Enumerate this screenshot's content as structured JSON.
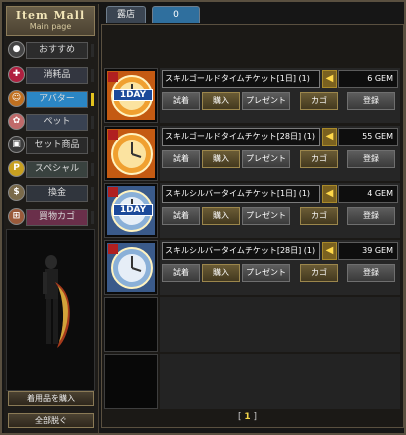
{
  "sidebar": {
    "title": "Item Mall",
    "subtitle": "Main page",
    "nav": [
      {
        "label": "おすすめ",
        "icon": "sphere-icon",
        "icon_color": "#444444",
        "label_bg": "#2c2c2c"
      },
      {
        "label": "消耗品",
        "icon": "potion-icon",
        "icon_color": "#b02040",
        "label_bg": "#333640"
      },
      {
        "label": "アバター",
        "icon": "avatar-icon",
        "icon_color": "#c07020",
        "label_bg": "#2b86c4"
      },
      {
        "label": "ペット",
        "icon": "pet-icon",
        "icon_color": "#c06a6a",
        "label_bg": "#394252"
      },
      {
        "label": "セット商品",
        "icon": "set-icon",
        "icon_color": "#3a3a3a",
        "label_bg": "#2a2a2a"
      },
      {
        "label": "スペシャル",
        "icon": "special-icon",
        "icon_color": "#c8a020",
        "label_bg": "#39423f"
      },
      {
        "label": "換金",
        "icon": "exchange-icon",
        "icon_color": "#7a6a4a",
        "label_bg": "#30353d"
      },
      {
        "label": "買物カゴ",
        "icon": "cart-icon",
        "icon_color": "#9a5a3a",
        "label_bg": "#6a2f4a"
      }
    ],
    "buttons": {
      "wear_buy": "着用品を購入",
      "remove_all": "全部脱ぐ"
    }
  },
  "tabs": [
    {
      "label": "露店"
    },
    {
      "label": "0"
    }
  ],
  "items": [
    {
      "name": "スキルゴールドタイムチケット[1日] (1)",
      "price": "6 GEM",
      "ticket": "gold-1day"
    },
    {
      "name": "スキルゴールドタイムチケット[28日] (1)",
      "price": "55 GEM",
      "ticket": "gold-28day"
    },
    {
      "name": "スキルシルバータイムチケット[1日] (1)",
      "price": "4 GEM",
      "ticket": "silver-1day"
    },
    {
      "name": "スキルシルバータイムチケット[28日] (1)",
      "price": "39 GEM",
      "ticket": "silver-28day"
    }
  ],
  "item_buttons": {
    "try": "試着",
    "buy": "購入",
    "gift": "プレゼント",
    "cart": "カゴ",
    "register": "登録"
  },
  "badge_text": "1DAY",
  "pagination": {
    "page": "1"
  },
  "colors": {
    "accent_gold": "#e3c21e",
    "tab_active": "#2f6f9e",
    "price_coin": "#ffd84a"
  }
}
